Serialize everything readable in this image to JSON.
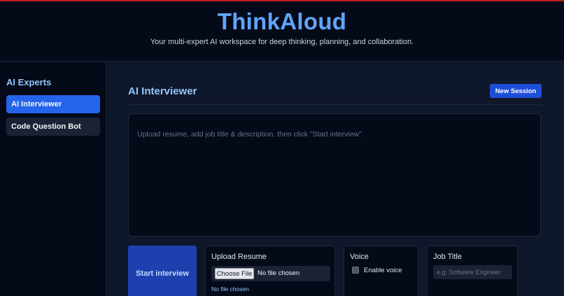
{
  "header": {
    "title": "ThinkAloud",
    "subtitle": "Your multi-expert AI workspace for deep thinking, planning, and collaboration."
  },
  "sidebar": {
    "heading": "AI Experts",
    "items": [
      {
        "label": "AI Interviewer",
        "active": true
      },
      {
        "label": "Code Question Bot",
        "active": false
      }
    ]
  },
  "main": {
    "title": "AI Interviewer",
    "new_session_label": "New Session",
    "chat_placeholder": "Upload resume, add job title & description, then click \"Start interview\".",
    "start_button_label": "Start interview",
    "upload": {
      "title": "Upload Resume",
      "choose_label": "Choose File",
      "file_status": "No file chosen",
      "note": "No file chosen"
    },
    "voice": {
      "title": "Voice",
      "checkbox_label": "Enable voice",
      "checked": false
    },
    "job": {
      "title": "Job Title",
      "placeholder": "e.g. Software Engineer"
    }
  },
  "colors": {
    "accent": "#2563eb",
    "title": "#60a5fa",
    "background": "#0f172a"
  }
}
